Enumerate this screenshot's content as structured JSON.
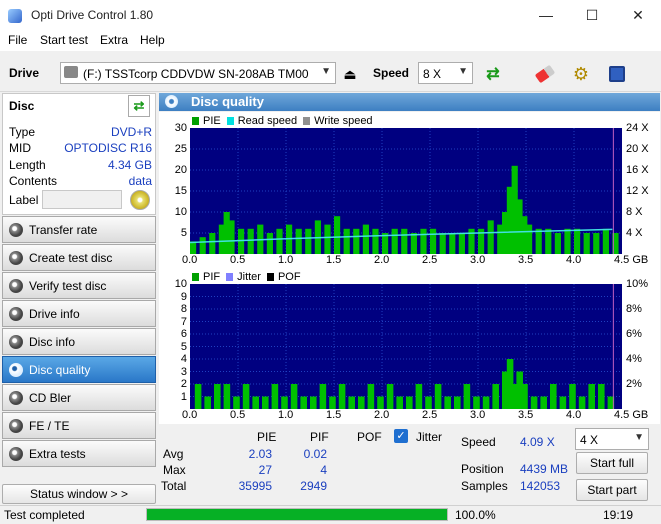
{
  "window": {
    "title": "Opti Drive Control 1.80",
    "minimize": "—",
    "maximize": "☐",
    "close": "✕"
  },
  "menu": [
    "File",
    "Start test",
    "Extra",
    "Help"
  ],
  "drivebar": {
    "drive_label": "Drive",
    "drive_value": "(F:)  TSSTcorp CDDVDW SN-208AB TM00",
    "speed_label": "Speed",
    "speed_value": "8 X"
  },
  "disc": {
    "heading": "Disc",
    "type_label": "Type",
    "type_value": "DVD+R",
    "mid_label": "MID",
    "mid_value": "OPTODISC R16",
    "length_label": "Length",
    "length_value": "4.34 GB",
    "contents_label": "Contents",
    "contents_value": "data",
    "label_label": "Label",
    "label_value": ""
  },
  "nav": [
    "Transfer rate",
    "Create test disc",
    "Verify test disc",
    "Drive info",
    "Disc info",
    "Disc quality",
    "CD Bler",
    "FE / TE",
    "Extra tests"
  ],
  "nav_active": "Disc quality",
  "status_window_label": "Status window > >",
  "panel_title": "Disc quality",
  "chart1": {
    "legend": [
      "PIE",
      "Read speed",
      "Write speed"
    ],
    "legend_colors": [
      "#00a000",
      "#00e0e0",
      "#909090"
    ],
    "y_left_ticks": [
      "30",
      "25",
      "20",
      "15",
      "10",
      "5"
    ],
    "y_right_ticks": [
      "24 X",
      "20 X",
      "16 X",
      "12 X",
      "8 X",
      "4 X"
    ],
    "x_ticks": [
      "0.0",
      "0.5",
      "1.0",
      "1.5",
      "2.0",
      "2.5",
      "3.0",
      "3.5",
      "4.0",
      "4.5 GB"
    ]
  },
  "chart2": {
    "legend": [
      "PIF",
      "Jitter",
      "POF"
    ],
    "legend_colors": [
      "#00a000",
      "#8080ff",
      "#000000"
    ],
    "y_left_ticks": [
      "10",
      "9",
      "8",
      "7",
      "6",
      "5",
      "4",
      "3",
      "2",
      "1"
    ],
    "y_right_ticks": [
      "10%",
      "8%",
      "6%",
      "4%",
      "2%"
    ],
    "x_ticks": [
      "0.0",
      "0.5",
      "1.0",
      "1.5",
      "2.0",
      "2.5",
      "3.0",
      "3.5",
      "4.0",
      "4.5 GB"
    ]
  },
  "chart_data": [
    {
      "type": "bar",
      "legend_position": "top-left",
      "x_range": [
        0,
        4.5
      ],
      "y_range": [
        0,
        30
      ],
      "y2_range": [
        0,
        24
      ],
      "series": [
        {
          "name": "PIE",
          "x": [
            0.0,
            0.1,
            0.2,
            0.3,
            0.35,
            0.4,
            0.5,
            0.6,
            0.7,
            0.8,
            0.9,
            1.0,
            1.1,
            1.2,
            1.3,
            1.4,
            1.5,
            1.6,
            1.7,
            1.8,
            1.9,
            2.0,
            2.1,
            2.2,
            2.3,
            2.4,
            2.5,
            2.6,
            2.7,
            2.8,
            2.9,
            3.0,
            3.1,
            3.2,
            3.25,
            3.3,
            3.35,
            3.4,
            3.45,
            3.5,
            3.6,
            3.7,
            3.8,
            3.9,
            4.0,
            4.1,
            4.2,
            4.3,
            4.4
          ],
          "values": [
            3,
            4,
            5,
            7,
            10,
            8,
            6,
            6,
            7,
            5,
            6,
            7,
            6,
            6,
            8,
            7,
            9,
            6,
            6,
            7,
            6,
            5,
            6,
            6,
            5,
            6,
            6,
            5,
            5,
            5,
            6,
            6,
            8,
            7,
            10,
            16,
            21,
            13,
            9,
            7,
            6,
            6,
            5,
            6,
            6,
            5,
            5,
            6,
            5
          ]
        },
        {
          "name": "Read speed",
          "x": [
            0.0,
            1.0,
            2.0,
            3.0,
            4.0,
            4.4
          ],
          "values": [
            2.2,
            2.9,
            3.5,
            4.0,
            4.5,
            4.7
          ]
        }
      ]
    },
    {
      "type": "bar",
      "legend_position": "top-left",
      "x_range": [
        0,
        4.5
      ],
      "y_range": [
        0,
        10
      ],
      "y2_range": [
        0,
        10
      ],
      "series": [
        {
          "name": "PIF",
          "x": [
            0.05,
            0.15,
            0.25,
            0.35,
            0.45,
            0.55,
            0.65,
            0.75,
            0.85,
            0.95,
            1.05,
            1.15,
            1.25,
            1.35,
            1.45,
            1.55,
            1.65,
            1.75,
            1.85,
            1.95,
            2.05,
            2.15,
            2.25,
            2.35,
            2.45,
            2.55,
            2.65,
            2.75,
            2.85,
            2.95,
            3.05,
            3.15,
            3.25,
            3.3,
            3.35,
            3.4,
            3.45,
            3.55,
            3.65,
            3.75,
            3.85,
            3.95,
            4.05,
            4.15,
            4.25,
            4.35
          ],
          "values": [
            2,
            1,
            2,
            2,
            1,
            2,
            1,
            1,
            2,
            1,
            2,
            1,
            1,
            2,
            1,
            2,
            1,
            1,
            2,
            1,
            2,
            1,
            1,
            2,
            1,
            2,
            1,
            1,
            2,
            1,
            1,
            2,
            3,
            4,
            2,
            3,
            2,
            1,
            1,
            2,
            1,
            2,
            1,
            2,
            2,
            1
          ]
        }
      ]
    }
  ],
  "stats": {
    "col_pie": "PIE",
    "col_pif": "PIF",
    "col_pof": "POF",
    "jitter_label": "Jitter",
    "avg_label": "Avg",
    "avg_pie": "2.03",
    "avg_pif": "0.02",
    "max_label": "Max",
    "max_pie": "27",
    "max_pif": "4",
    "total_label": "Total",
    "total_pie": "35995",
    "total_pif": "2949",
    "speed_label": "Speed",
    "speed_value": "4.09 X",
    "speed_select": "4 X",
    "position_label": "Position",
    "position_value": "4439 MB",
    "samples_label": "Samples",
    "samples_value": "142053",
    "start_full": "Start full",
    "start_part": "Start part"
  },
  "status": {
    "text": "Test completed",
    "progress_value": 1.0,
    "progress_text": "100.0%",
    "time": "19:19"
  },
  "colors": {
    "accent": "#2a77c8",
    "chart_bg": "#000080",
    "pie_green": "#00c000",
    "progress_green": "#06b025"
  }
}
